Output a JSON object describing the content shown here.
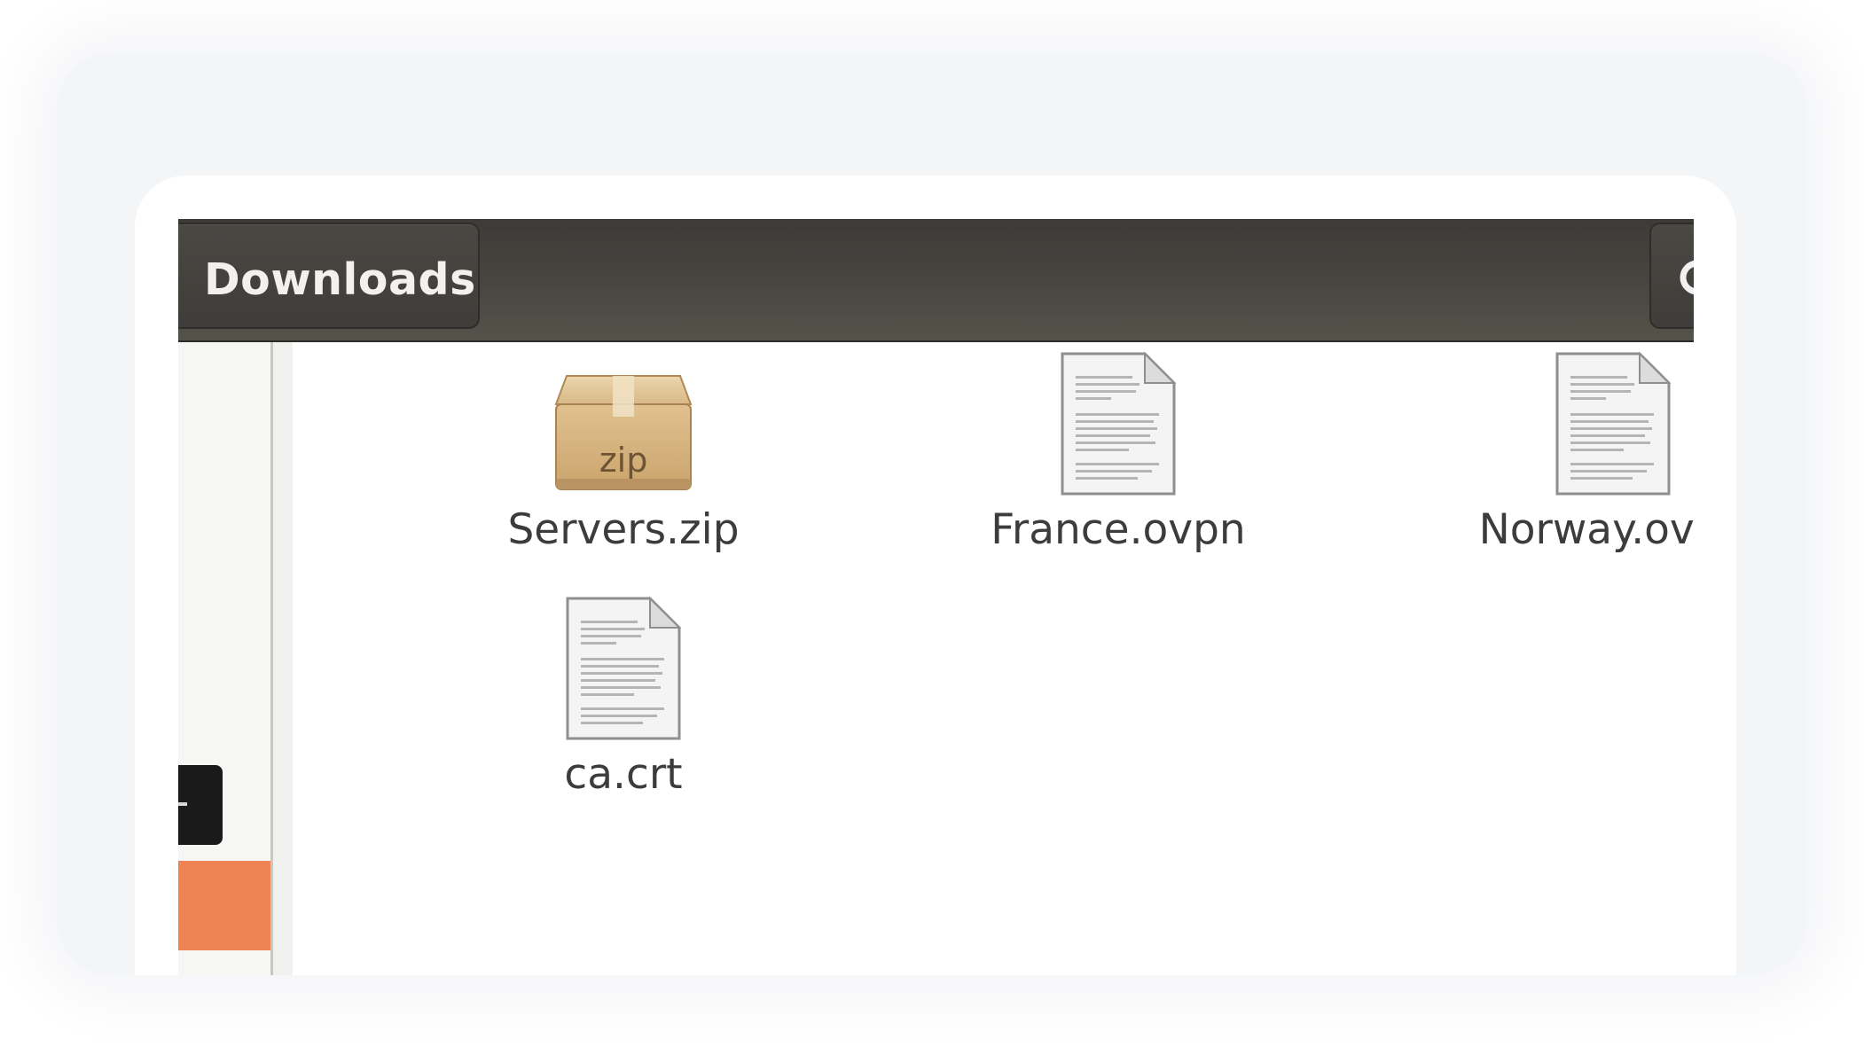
{
  "window": {
    "path_label": "Downloads"
  },
  "files": [
    {
      "name": "Servers.zip",
      "icon": "zip-archive-icon",
      "icon_text": "zip"
    },
    {
      "name": "France.ovpn",
      "icon": "text-document-icon"
    },
    {
      "name": "Norway.ovpn",
      "icon": "text-document-icon"
    },
    {
      "name": "ca.crt",
      "icon": "text-document-icon"
    }
  ],
  "colors": {
    "headerbar": "#46443f",
    "selection_accent": "#ee8454",
    "file_label": "#3c3c3c"
  }
}
